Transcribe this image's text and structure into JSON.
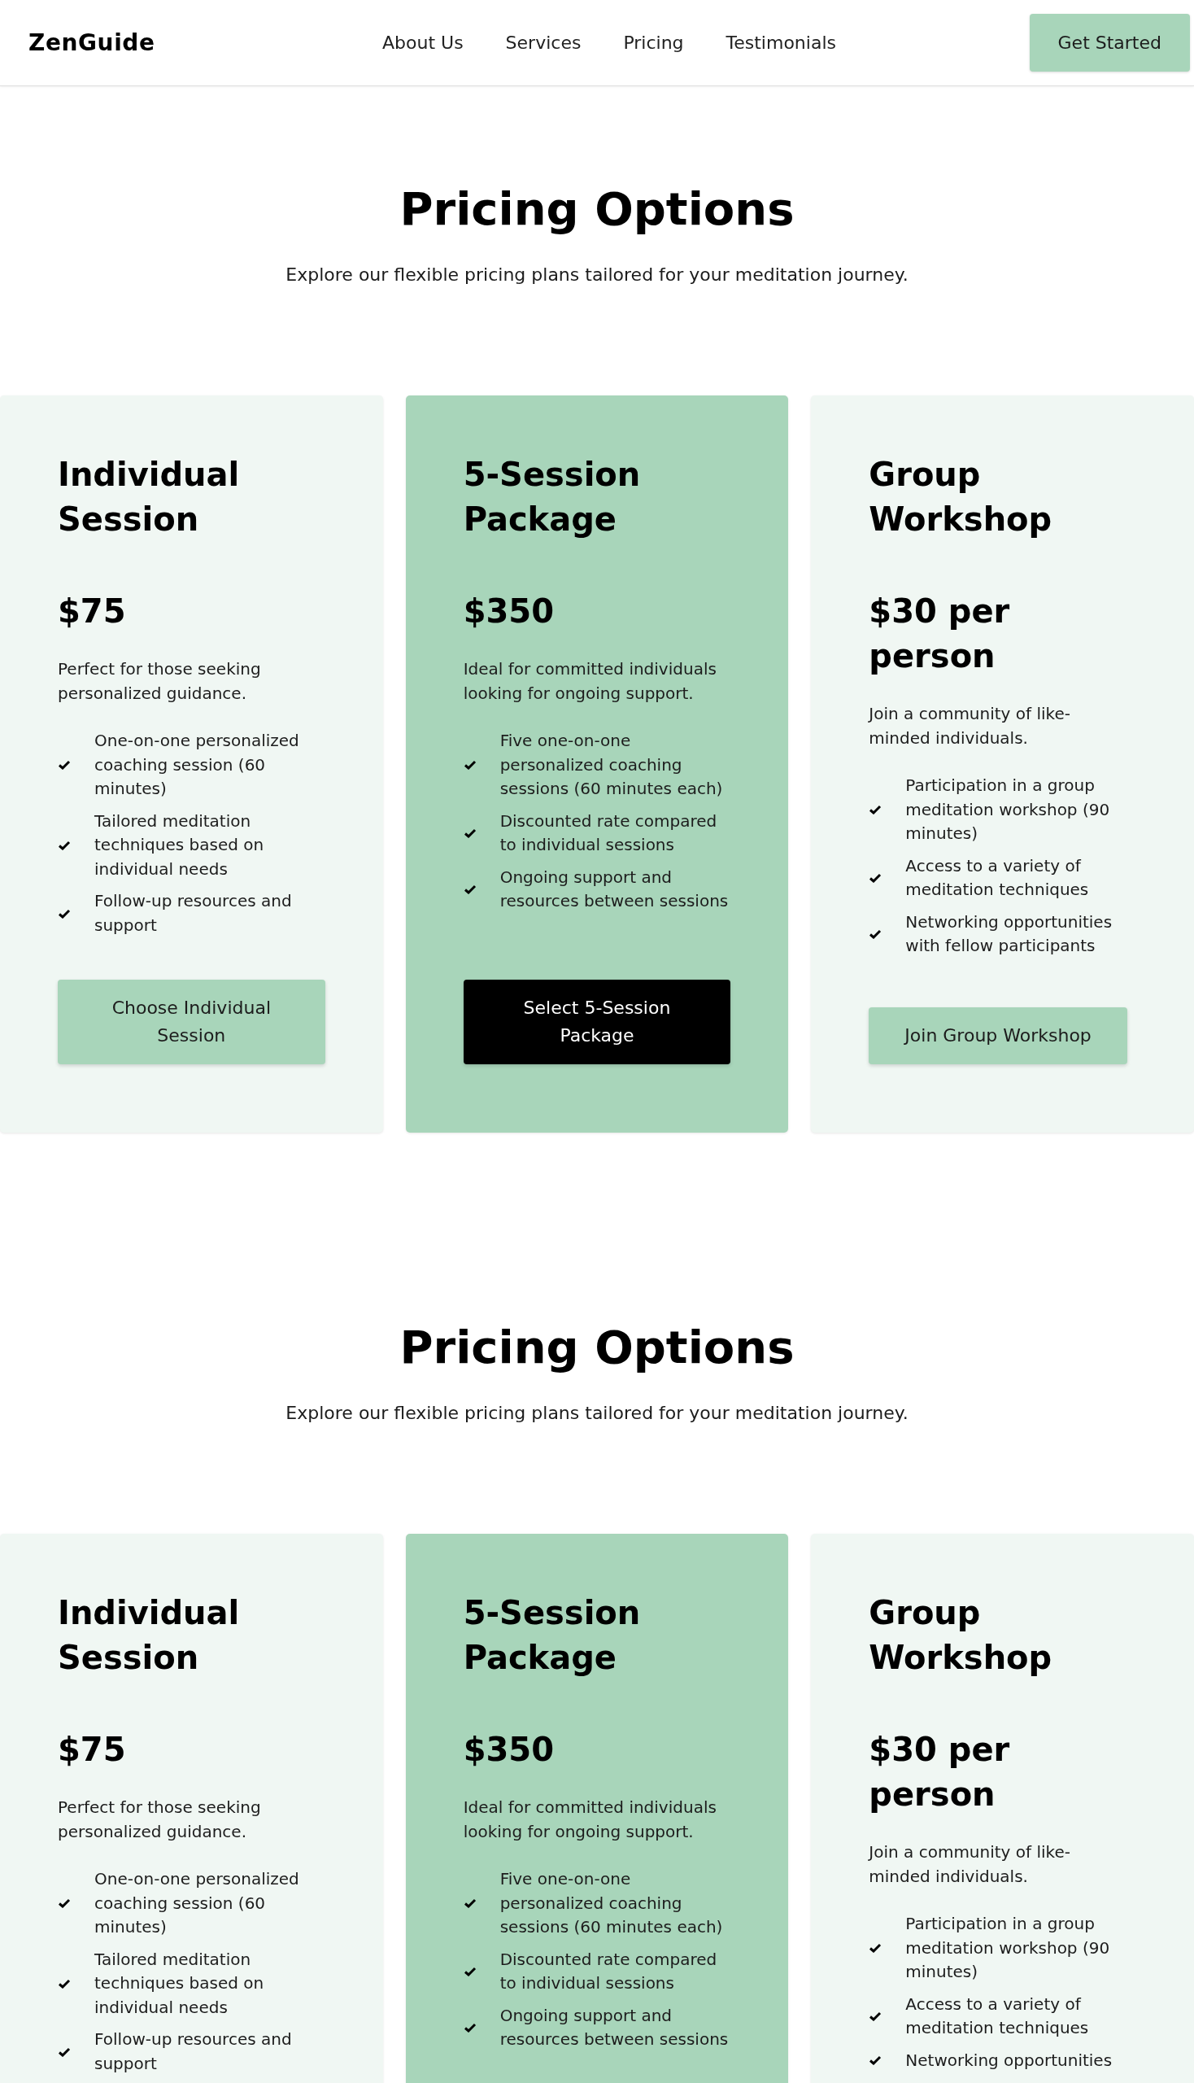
{
  "header": {
    "logo": "ZenGuide",
    "nav": [
      "About Us",
      "Services",
      "Pricing",
      "Testimonials"
    ],
    "cta": "Get Started"
  },
  "sections": [
    {
      "title": "Pricing Options",
      "subtitle": "Explore our flexible pricing plans tailored for your meditation journey.",
      "plans": [
        {
          "name": "Individual Session",
          "price": "$75",
          "description": "Perfect for those seeking personalized guidance.",
          "features": [
            "One-on-one personalized coaching session (60 minutes)",
            "Tailored meditation techniques based on individual needs",
            "Follow-up resources and support"
          ],
          "button": "Choose Individual Session",
          "featured": false
        },
        {
          "name": "5-Session Package",
          "price": "$350",
          "description": "Ideal for committed individuals looking for ongoing support.",
          "features": [
            "Five one-on-one personalized coaching sessions (60 minutes each)",
            "Discounted rate compared to individual sessions",
            "Ongoing support and resources between sessions"
          ],
          "button": "Select 5-Session Package",
          "featured": true
        },
        {
          "name": "Group Workshop",
          "price": "$30 per person",
          "description": "Join a community of like-minded individuals.",
          "features": [
            "Participation in a group meditation workshop (90 minutes)",
            "Access to a variety of meditation techniques",
            "Networking opportunities with fellow participants"
          ],
          "button": "Join Group Workshop",
          "featured": false
        }
      ]
    },
    {
      "title": "Pricing Options",
      "subtitle": "Explore our flexible pricing plans tailored for your meditation journey.",
      "plans": [
        {
          "name": "Individual Session",
          "price": "$75",
          "description": "Perfect for those seeking personalized guidance.",
          "features": [
            "One-on-one personalized coaching session (60 minutes)",
            "Tailored meditation techniques based on individual needs",
            "Follow-up resources and support"
          ],
          "featured": false
        },
        {
          "name": "5-Session Package",
          "price": "$350",
          "description": "Ideal for committed individuals looking for ongoing support.",
          "features": [
            "Five one-on-one personalized coaching sessions (60 minutes each)",
            "Discounted rate compared to individual sessions",
            "Ongoing support and resources between sessions"
          ],
          "featured": true
        },
        {
          "name": "Group Workshop",
          "price": "$30 per person",
          "description": "Join a community of like-minded individuals.",
          "features": [
            "Participation in a group meditation workshop (90 minutes)",
            "Access to a variety of meditation techniques",
            "Networking opportunities"
          ],
          "featured": false
        }
      ]
    }
  ]
}
